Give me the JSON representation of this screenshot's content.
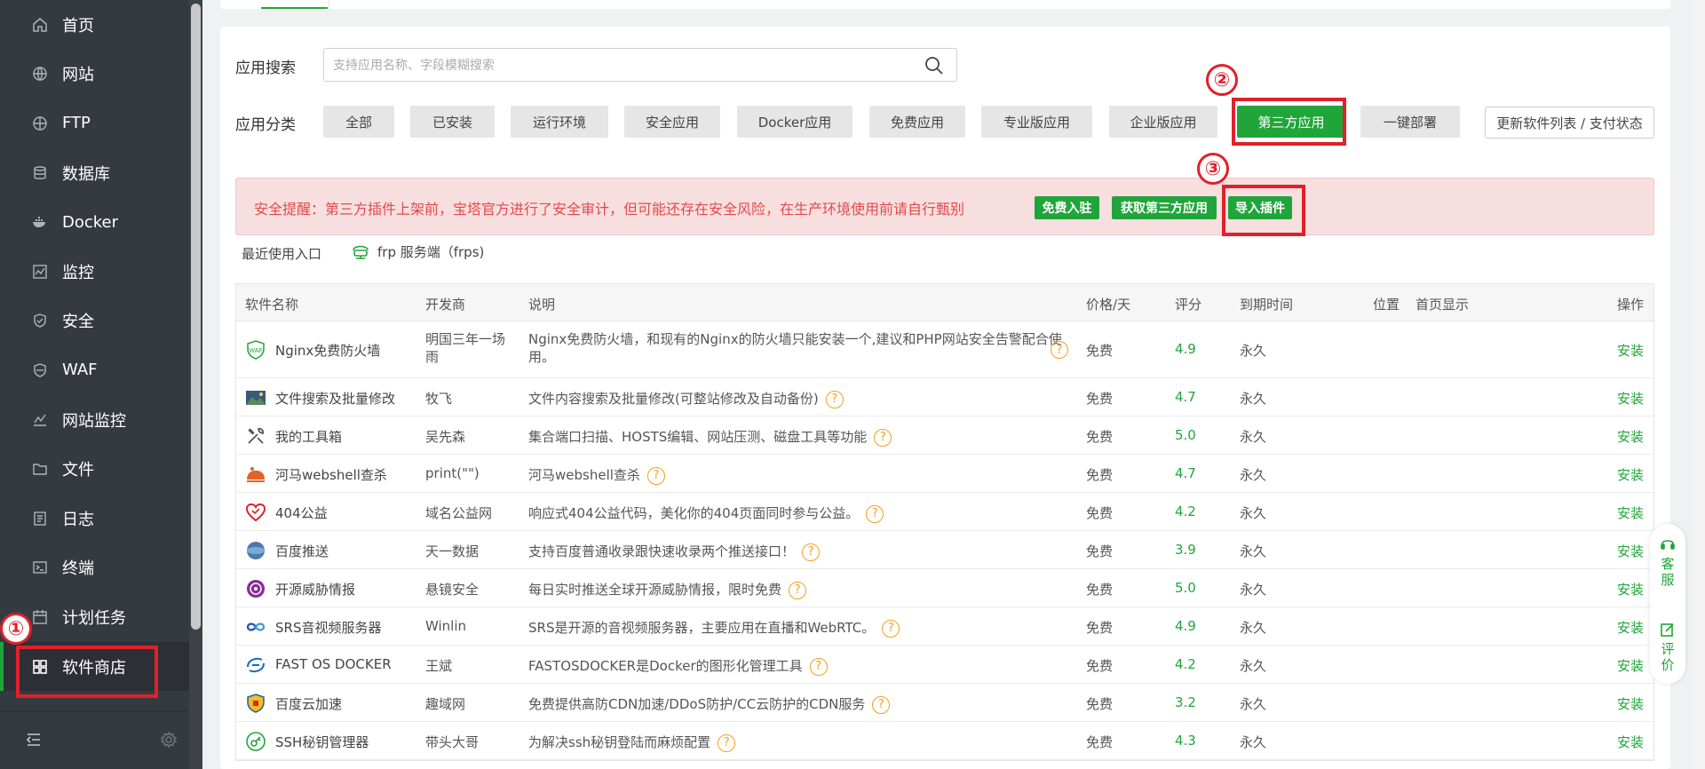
{
  "sidebar": {
    "items": [
      {
        "label": "首页",
        "icon": "home-icon"
      },
      {
        "label": "网站",
        "icon": "globe-icon"
      },
      {
        "label": "FTP",
        "icon": "ftp-icon"
      },
      {
        "label": "数据库",
        "icon": "database-icon"
      },
      {
        "label": "Docker",
        "icon": "docker-icon"
      },
      {
        "label": "监控",
        "icon": "monitor-icon"
      },
      {
        "label": "安全",
        "icon": "shield-icon"
      },
      {
        "label": "WAF",
        "icon": "waf-icon"
      },
      {
        "label": "网站监控",
        "icon": "site-monitor-icon"
      },
      {
        "label": "文件",
        "icon": "folder-icon"
      },
      {
        "label": "日志",
        "icon": "log-icon"
      },
      {
        "label": "终端",
        "icon": "terminal-icon"
      },
      {
        "label": "计划任务",
        "icon": "calendar-icon"
      },
      {
        "label": "软件商店",
        "icon": "grid-icon",
        "active": true
      }
    ]
  },
  "search": {
    "label": "应用搜索",
    "placeholder": "支持应用名称、字段模糊搜索"
  },
  "category": {
    "label": "应用分类",
    "items": [
      "全部",
      "已安装",
      "运行环境",
      "安全应用",
      "Docker应用",
      "免费应用",
      "专业版应用",
      "企业版应用",
      "第三方应用",
      "一键部署"
    ],
    "active": "第三方应用",
    "update_button": "更新软件列表 / 支付状态"
  },
  "annotations": [
    "①",
    "②",
    "③"
  ],
  "alert": {
    "text": "安全提醒：第三方插件上架前，宝塔官方进行了安全审计，但可能还存在安全风险，在生产环境使用前请自行甄别",
    "buttons": [
      "免费入驻",
      "获取第三方应用",
      "导入插件"
    ]
  },
  "recent": {
    "label": "最近使用入口",
    "item": "frp 服务端（frps)"
  },
  "table": {
    "headers": [
      "软件名称",
      "开发商",
      "说明",
      "价格/天",
      "评分",
      "到期时间",
      "位置",
      "首页显示",
      "操作"
    ],
    "rows": [
      {
        "name": "Nginx免费防火墙",
        "dev": "明国三年一场雨",
        "desc": "Nginx免费防火墙，和现有的Nginx的防火墙只能安装一个,建议和PHP网站安全告警配合使用。",
        "price": "免费",
        "score": "4.9",
        "expire": "永久",
        "op": "安装",
        "icon": "waf-shield-icon"
      },
      {
        "name": "文件搜索及批量修改",
        "dev": "牧飞",
        "desc": "文件内容搜索及批量修改(可整站修改及自动备份)",
        "price": "免费",
        "score": "4.7",
        "expire": "永久",
        "op": "安装",
        "icon": "landscape-icon"
      },
      {
        "name": "我的工具箱",
        "dev": "吴先森",
        "desc": "集合端口扫描、HOSTS编辑、网站压测、磁盘工具等功能",
        "price": "免费",
        "score": "5.0",
        "expire": "永久",
        "op": "安装",
        "icon": "tools-icon"
      },
      {
        "name": "河马webshell查杀",
        "dev": "print(\"\")",
        "desc": "河马webshell查杀",
        "price": "免费",
        "score": "4.7",
        "expire": "永久",
        "op": "安装",
        "icon": "hippo-icon"
      },
      {
        "name": "404公益",
        "dev": "域名公益网",
        "desc": "响应式404公益代码，美化你的404页面同时参与公益。",
        "price": "免费",
        "score": "4.2",
        "expire": "永久",
        "op": "安装",
        "icon": "heart-icon"
      },
      {
        "name": "百度推送",
        "dev": "天一数据",
        "desc": "支持百度普通收录跟快速收录两个推送接口！",
        "price": "免费",
        "score": "3.9",
        "expire": "永久",
        "op": "安装",
        "icon": "push-icon"
      },
      {
        "name": "开源威胁情报",
        "dev": "悬镜安全",
        "desc": "每日实时推送全球开源威胁情报，限时免费",
        "price": "免费",
        "score": "5.0",
        "expire": "永久",
        "op": "安装",
        "icon": "radar-icon"
      },
      {
        "name": "SRS音视频服务器",
        "dev": "Winlin",
        "desc": "SRS是开源的音视频服务器，主要应用在直播和WebRTC。",
        "price": "免费",
        "score": "4.9",
        "expire": "永久",
        "op": "安装",
        "icon": "infinity-icon"
      },
      {
        "name": "FAST OS DOCKER",
        "dev": "王斌",
        "desc": "FASTOSDOCKER是Docker的图形化管理工具",
        "price": "免费",
        "score": "4.2",
        "expire": "永久",
        "op": "安装",
        "icon": "fastos-icon"
      },
      {
        "name": "百度云加速",
        "dev": "趣域网",
        "desc": "免费提供高防CDN加速/DDoS防护/CC云防护的CDN服务",
        "price": "免费",
        "score": "3.2",
        "expire": "永久",
        "op": "安装",
        "icon": "cloud-shield-icon"
      },
      {
        "name": "SSH秘钥管理器",
        "dev": "带头大哥",
        "desc": "为解决ssh秘钥登陆而麻烦配置",
        "price": "免费",
        "score": "4.3",
        "expire": "永久",
        "op": "安装",
        "icon": "key-icon"
      }
    ]
  },
  "float": {
    "service": "客服",
    "review": "评价"
  },
  "colors": {
    "accent": "#20a53a",
    "sidebar": "#353a40",
    "annotation": "#e0202a",
    "alert_bg": "#f7dfe0",
    "alert_text": "#e34a4a"
  }
}
